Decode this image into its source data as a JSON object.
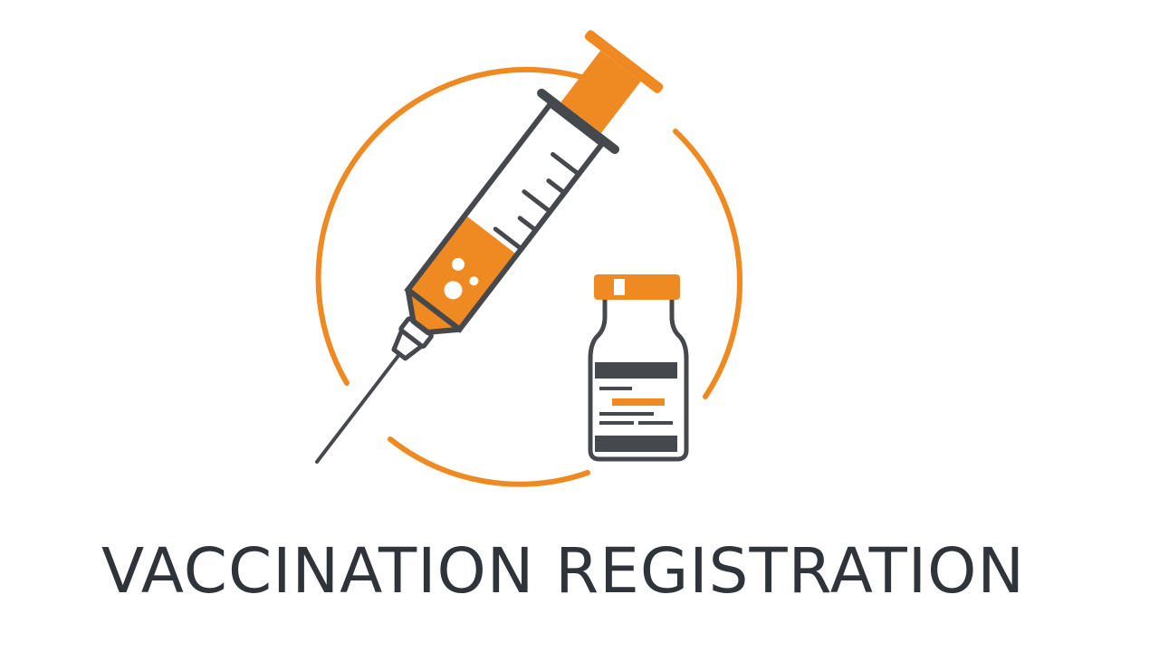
{
  "title": "VACCINATION REGISTRATION",
  "icons": {
    "emblem": "vaccination-emblem",
    "ring": "ring-icon",
    "syringe": "syringe-icon",
    "vial": "vial-icon"
  },
  "colors": {
    "accent": "#ef8a22",
    "ink": "#45484d",
    "text": "#2f343b",
    "background": "#ffffff"
  }
}
